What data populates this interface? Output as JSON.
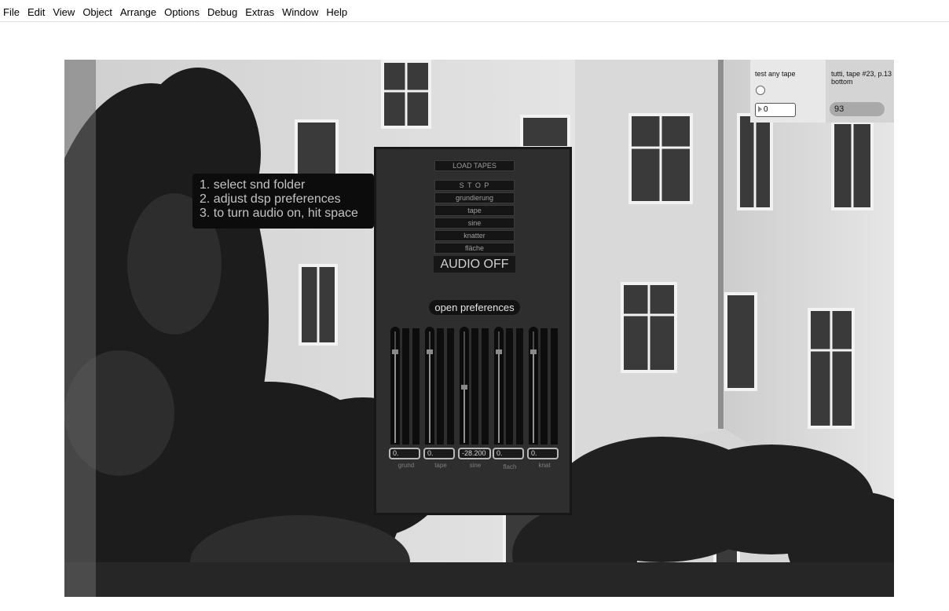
{
  "menu": [
    "File",
    "Edit",
    "View",
    "Object",
    "Arrange",
    "Options",
    "Debug",
    "Extras",
    "Window",
    "Help"
  ],
  "instructions": {
    "line1": "1. select snd folder",
    "line2": "2. adjust dsp preferences",
    "line3": "3. to turn audio on, hit space"
  },
  "panel": {
    "load_tapes": "LOAD TAPES",
    "stop": "S T O P",
    "buttons": [
      "grundierung",
      "tape",
      "sine",
      "knatter",
      "fläche"
    ],
    "audio": "AUDIO OFF",
    "open_prefs": "open  preferences",
    "channels": [
      {
        "label": "grund",
        "value": "0.",
        "level": 0.82
      },
      {
        "label": "tape",
        "value": "0.",
        "level": 0.82
      },
      {
        "label": "sine",
        "value": "-28.200",
        "level": 0.5
      },
      {
        "label": "flach",
        "value": "0.",
        "level": 0.82
      },
      {
        "label": "knat",
        "value": "0.",
        "level": 0.82
      }
    ]
  },
  "test_any_tape": {
    "label": "test any tape",
    "value": "0"
  },
  "tutti": {
    "label": "tutti, tape #23, p.13 bottom",
    "value": "93"
  },
  "colors": {
    "panel": "#2e2e2e",
    "panel_border": "#171717",
    "button": "#151515"
  }
}
